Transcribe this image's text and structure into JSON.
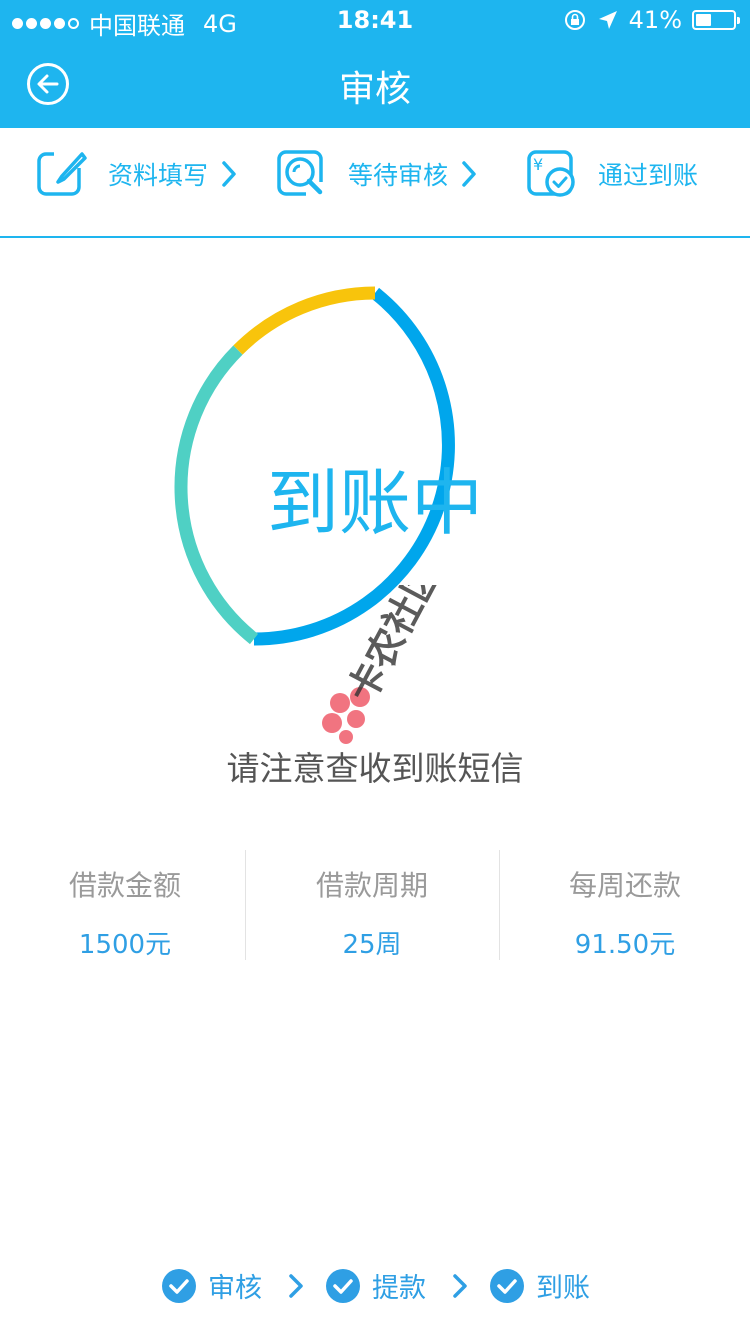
{
  "status_bar": {
    "carrier": "中国联通",
    "network": "4G",
    "time": "18:41",
    "battery": "41%",
    "battery_level": 0.41
  },
  "nav": {
    "title": "审核",
    "back_icon": "arrow-left-circle-icon"
  },
  "steps": [
    {
      "label": "资料填写",
      "icon": "edit-icon"
    },
    {
      "label": "等待审核",
      "icon": "search-review-icon"
    },
    {
      "label": "通过到账",
      "icon": "yuan-check-icon"
    }
  ],
  "progress": {
    "status_text": "到账中",
    "ring_colors": [
      "#00a6ec",
      "#4fd0c4",
      "#f8c40c"
    ]
  },
  "notice": "请注意查收到账短信",
  "watermark_text": "卡农社区",
  "loan": [
    {
      "label": "借款金额",
      "value": "1500元"
    },
    {
      "label": "借款周期",
      "value": "25周"
    },
    {
      "label": "每周还款",
      "value": "91.50元"
    }
  ],
  "bottom_steps": [
    {
      "label": "审核",
      "icon": "check-circle-icon"
    },
    {
      "label": "提款",
      "icon": "check-circle-icon"
    },
    {
      "label": "到账",
      "icon": "check-circle-icon"
    }
  ],
  "colors": {
    "brand": "#1eb5ef",
    "ring_blue": "#00a6ec",
    "ring_teal": "#4fd0c4",
    "ring_yellow": "#f8c40c",
    "value_blue": "#2f9fe4"
  }
}
